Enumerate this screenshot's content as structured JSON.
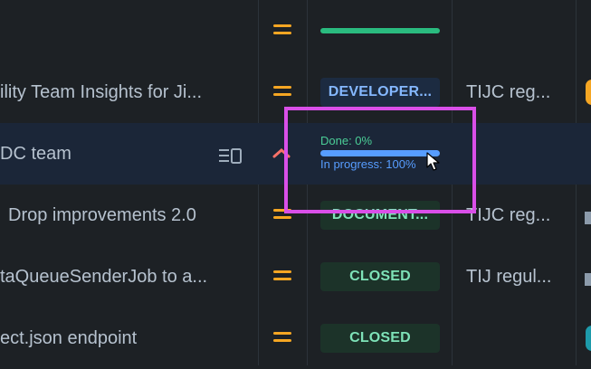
{
  "rows": [
    {
      "summary": "",
      "priority": "medium-priority",
      "status": "",
      "sprint": ""
    },
    {
      "summary": "ility Team Insights for Ji...",
      "priority": "medium-priority",
      "status": "DEVELOPER...",
      "sprint": "TIJC reg..."
    },
    {
      "summary": "DC team",
      "priority": "high-priority",
      "progress": {
        "done_label": "Done: 0%",
        "in_progress_label": "In progress: 100%",
        "done_pct": 0,
        "in_progress_pct": 100
      },
      "sprint": ""
    },
    {
      "summary": "Drop improvements 2.0",
      "priority": "medium-priority",
      "status": "DOCUMENT...",
      "sprint": "TIJC reg..."
    },
    {
      "summary": "taQueueSenderJob to a...",
      "priority": "medium-priority",
      "status": "CLOSED",
      "sprint": "TIJ regul..."
    },
    {
      "summary": "ect.json endpoint",
      "priority": "medium-priority",
      "status": "CLOSED",
      "sprint": ""
    }
  ],
  "colors": {
    "background": "#1d2125",
    "highlight_row": "#1b2638",
    "priority_medium": "#f5a623",
    "priority_high": "#f87168",
    "status_dev_bg": "#1c2b41",
    "status_dev_text": "#85b8ff",
    "status_done_bg": "#1c3329",
    "status_done_text": "#7ee2b8",
    "focus_outline": "#d94fe8"
  }
}
